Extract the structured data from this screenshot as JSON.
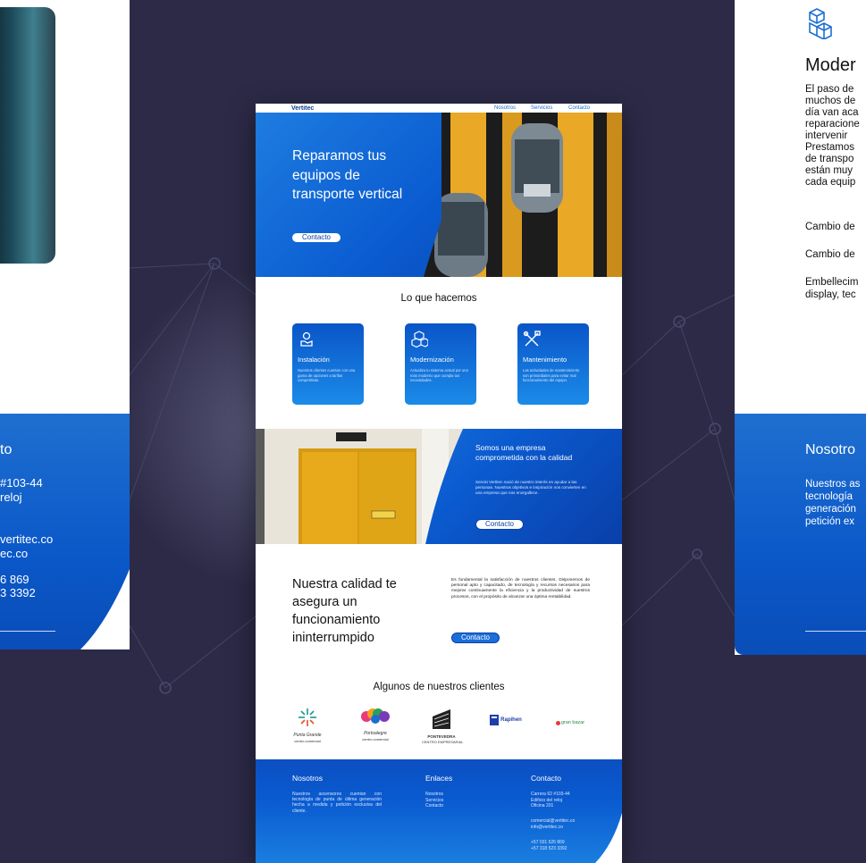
{
  "left_panel": {
    "heading": "to",
    "address_1": "#103-44",
    "address_2": "reloj",
    "email_1": "vertitec.co",
    "email_2": "ec.co",
    "phone_1": "6 869",
    "phone_2": "3 3392"
  },
  "right_panel": {
    "heading": "Moder",
    "lines": [
      "El paso de",
      "muchos de",
      "día van aca",
      "reparacione",
      "intervenir",
      "Prestamos",
      "de transpo",
      "están muy",
      "cada equip"
    ],
    "items": [
      "Cambio de",
      "Cambio de",
      "Embellecim",
      "display, tec"
    ],
    "footer_heading": "Nosotro",
    "footer_lines": [
      "Nuestros as",
      "tecnología",
      "generación",
      "petición ex"
    ]
  },
  "page": {
    "nav": {
      "logo": "Vertitec",
      "links": [
        "Nosotros",
        "Servicios",
        "Contacto"
      ]
    },
    "hero": {
      "title": "Reparamos tus equipos de transporte vertical",
      "button": "Contacto"
    },
    "services": {
      "title": "Lo que hacemos",
      "cards": [
        {
          "icon": "hand-gear-icon",
          "title": "Instalación",
          "desc": "Nuestros clientes cuentan con una gama de opciones a tarifas competitivas."
        },
        {
          "icon": "boxes-icon",
          "title": "Modernización",
          "desc": "Actualiza tu sistema actual por uno más moderno que cumpla tus necesidades."
        },
        {
          "icon": "tools-icon",
          "title": "Mantenimiento",
          "desc": "Las actividades de mantenimiento son primordiales para evitar mal funcionamiento del equipo."
        }
      ]
    },
    "company": {
      "title": "Somos una empresa comprometida con la calidad",
      "text": "Servisi Vertitec nació de nuestro interés en ayudar a las personas. Nuestros objetivos e inspiración nos convierten en una empresa que nos enorgullece.",
      "button": "Contacto"
    },
    "quality": {
      "title": "Nuestra calidad te asegura un funcionamiento ininterrumpido",
      "text": "Es fundamental la satisfacción de nuestros clientes. Disponemos de personal apto y capacitado, de tecnología y recursos necesarios para mejorar continuamente la eficiencia y la productividad de nuestros procesos, con el propósito de alcanzar una óptima rentabilidad.",
      "button": "Contacto"
    },
    "clients": {
      "title": "Algunos de nuestros clientes",
      "logos": [
        {
          "name": "Punta Grande",
          "sub": "centro comercial"
        },
        {
          "name": "Portoalegre",
          "sub": "centro comercial"
        },
        {
          "name": "PONTEVEDRA",
          "sub": "CENTRO EMPRESARIAL"
        },
        {
          "name": "Rapihen",
          "sub": ""
        },
        {
          "name": "gran bazar",
          "sub": ""
        }
      ]
    },
    "footer": {
      "about_heading": "Nosotros",
      "about_text": "Nuestros ascensores cuentan con tecnología de punta de última generación hecha a medida y petición exclusiva del cliente.",
      "links_heading": "Enlaces",
      "links": [
        "Nosotros",
        "Servicios",
        "Contacto"
      ],
      "contact_heading": "Contacto",
      "address": [
        "Carrera 62 #103-44",
        "Edificio del reloj",
        "Oficina 201"
      ],
      "emails": [
        "comercial@vertitec.co",
        "info@vertitec.co"
      ],
      "phones": [
        "+57 031 526 869",
        "+57 318 523 3392"
      ]
    }
  },
  "colors": {
    "background": "#2c2a47",
    "brand_blue": "#0a5bd0",
    "accent_yellow": "#e9a825"
  }
}
